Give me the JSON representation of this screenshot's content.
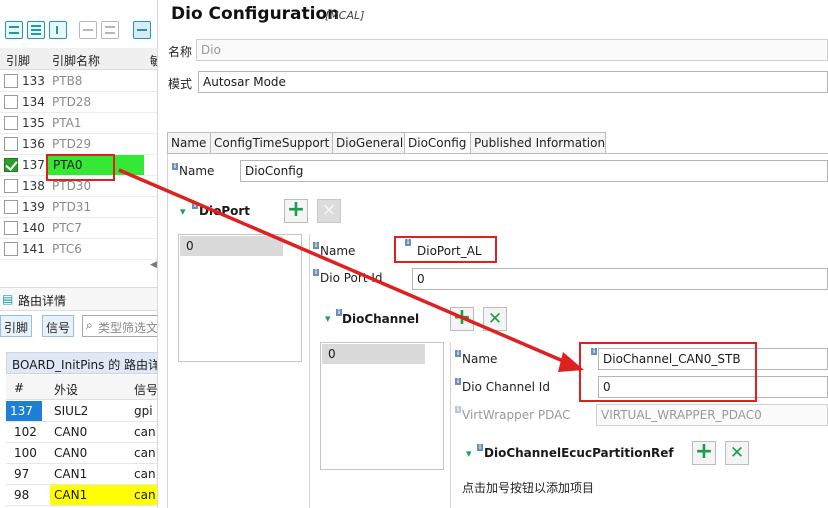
{
  "left": {
    "columns": {
      "pin": "引脚",
      "pin_name": "引脚名称",
      "extra": "敏"
    },
    "pins": [
      {
        "num": "133",
        "name": "PTB8",
        "checked": false
      },
      {
        "num": "134",
        "name": "PTD28",
        "checked": false
      },
      {
        "num": "135",
        "name": "PTA1",
        "checked": false
      },
      {
        "num": "136",
        "name": "PTD29",
        "checked": false
      },
      {
        "num": "137",
        "name": "PTA0",
        "checked": true
      },
      {
        "num": "138",
        "name": "PTD30",
        "checked": false
      },
      {
        "num": "139",
        "name": "PTD31",
        "checked": false
      },
      {
        "num": "140",
        "name": "PTC7",
        "checked": false
      },
      {
        "num": "141",
        "name": "PTC6",
        "checked": false
      }
    ],
    "route_tab": "路由详情",
    "filter_buttons": {
      "pin": "引脚",
      "signal": "信号"
    },
    "search_placeholder": "类型筛选文",
    "route_title": "BOARD_InitPins 的 路由详情",
    "route_columns": {
      "num": "#",
      "peripheral": "外设",
      "signal": "信号"
    },
    "routes": [
      {
        "num": "137",
        "peripheral": "SIUL2",
        "signal": "gpi",
        "highlight": "selected"
      },
      {
        "num": "102",
        "peripheral": "CAN0",
        "signal": "can",
        "highlight": ""
      },
      {
        "num": "100",
        "peripheral": "CAN0",
        "signal": "can",
        "highlight": ""
      },
      {
        "num": "97",
        "peripheral": "CAN1",
        "signal": "can",
        "highlight": ""
      },
      {
        "num": "98",
        "peripheral": "CAN1",
        "signal": "can",
        "highlight": "yellow"
      }
    ]
  },
  "header": {
    "title": "Dio Configuration",
    "subtitle": "[MCAL]"
  },
  "form": {
    "name_label": "名称",
    "name_value": "Dio",
    "mode_label": "模式",
    "mode_value": "Autosar Mode"
  },
  "tabs": [
    "Name",
    "ConfigTimeSupport",
    "DioGeneral",
    "DioConfig",
    "Published Information"
  ],
  "config": {
    "name_label": "Name",
    "name_value": "DioConfig",
    "dioport_section": "DioPort",
    "port_list": [
      "0"
    ],
    "port_name_label": "Name",
    "port_name_value": "DioPort_AL",
    "port_id_label": "Dio Port Id",
    "port_id_value": "0",
    "channel_section": "DioChannel",
    "channel_list": [
      "0"
    ],
    "ch_name_label": "Name",
    "ch_name_value": "DioChannel_CAN0_STB",
    "ch_id_label": "Dio Channel Id",
    "ch_id_value": "0",
    "virt_label": "VirtWrapper PDAC",
    "virt_value": "VIRTUAL_WRAPPER_PDAC0",
    "partition_section": "DioChannelEcucPartitionRef",
    "partition_hint": "点击加号按钮以添加项目"
  },
  "colors": {
    "accent": "#1e9aa8",
    "selected_pin": "#35e835",
    "annotation": "#e02020",
    "route_selected": "#1e7fd6",
    "route_yellow": "#ffff00"
  }
}
